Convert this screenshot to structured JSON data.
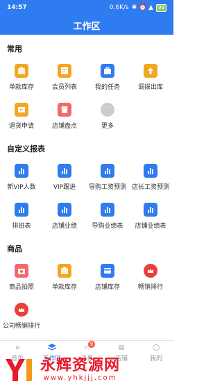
{
  "status": {
    "time": "14:57",
    "speed": "0.6K/s",
    "battery": "99"
  },
  "header": {
    "title": "工作区"
  },
  "sections": [
    {
      "title": "常用",
      "items": [
        {
          "label": "单款库存",
          "icon": "box-icon",
          "color": "#f4a623"
        },
        {
          "label": "会员列表",
          "icon": "member-card-icon",
          "color": "#f4a623"
        },
        {
          "label": "我的任务",
          "icon": "briefcase-icon",
          "color": "#2f7bf0"
        },
        {
          "label": "调拨出库",
          "icon": "upload-box-icon",
          "color": "#f4a623"
        },
        {
          "label": "退货申请",
          "icon": "return-box-icon",
          "color": "#f4a623"
        },
        {
          "label": "店铺盘点",
          "icon": "store-icon",
          "color": "#f06a6a"
        },
        {
          "label": "更多",
          "icon": "more-dots-icon",
          "color": "#cccccc"
        }
      ]
    },
    {
      "title": "自定义报表",
      "items": [
        {
          "label": "新VIP人数",
          "icon": "bar-chart-icon",
          "color": "#2f7bf0"
        },
        {
          "label": "VIP跟进",
          "icon": "bar-chart-icon",
          "color": "#2f7bf0"
        },
        {
          "label": "导购工资预测",
          "icon": "bar-chart-icon",
          "color": "#2f7bf0"
        },
        {
          "label": "店长工资预测",
          "icon": "bar-chart-icon",
          "color": "#2f7bf0"
        },
        {
          "label": "排班表",
          "icon": "bar-chart-icon",
          "color": "#2f7bf0"
        },
        {
          "label": "店铺业绩",
          "icon": "bar-chart-icon",
          "color": "#2f7bf0"
        },
        {
          "label": "导购业绩表",
          "icon": "bar-chart-icon",
          "color": "#2f7bf0"
        },
        {
          "label": "店铺业绩表",
          "icon": "bar-chart-icon",
          "color": "#2f7bf0"
        }
      ]
    },
    {
      "title": "商品",
      "items": [
        {
          "label": "商品拍照",
          "icon": "camera-icon",
          "color": "#f06a6a"
        },
        {
          "label": "单款库存",
          "icon": "box-icon",
          "color": "#f4a623"
        },
        {
          "label": "店铺库存",
          "icon": "inventory-card-icon",
          "color": "#2f7bf0"
        },
        {
          "label": "畅销排行",
          "icon": "crown-icon",
          "color": "#e8403a"
        },
        {
          "label": "公司畅销排行",
          "icon": "crown-icon",
          "color": "#e8403a"
        }
      ]
    }
  ],
  "bottom_nav": {
    "items": [
      {
        "label": "首页"
      },
      {
        "label": "工作区"
      },
      {
        "label": "消息",
        "badge": "9"
      },
      {
        "label": "店铺"
      },
      {
        "label": "我的"
      }
    ]
  },
  "watermark": {
    "text": "永辉资源网",
    "url": "www.yhkjjj.com"
  }
}
